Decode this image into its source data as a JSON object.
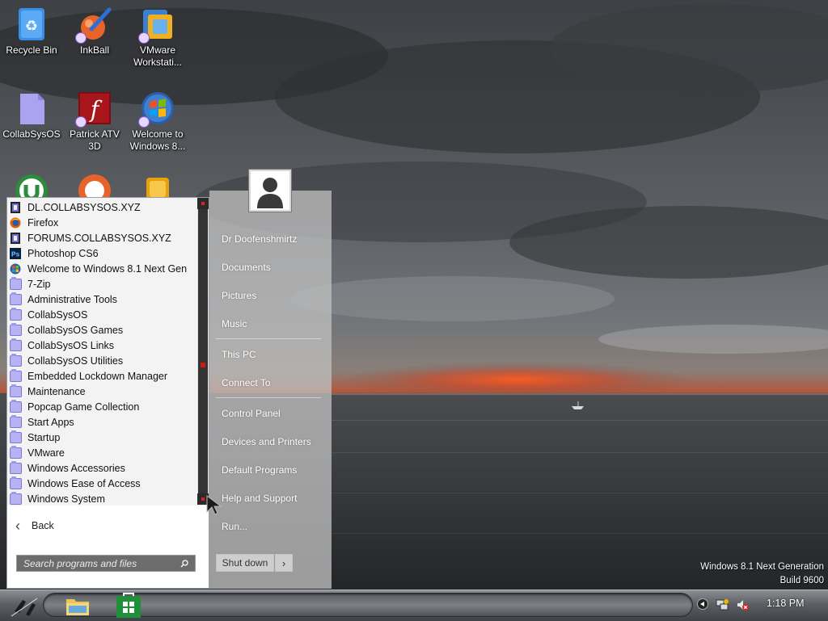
{
  "desktop": {
    "icons": [
      {
        "label": "Recycle Bin"
      },
      {
        "label": "InkBall"
      },
      {
        "label": "VMware Workstati..."
      },
      {
        "label": "CollabSysOS"
      },
      {
        "label": "Patrick ATV 3D"
      },
      {
        "label": "Welcome to Windows 8..."
      }
    ]
  },
  "start_menu": {
    "programs": [
      {
        "label": "DL.COLLABSYSOS.XYZ",
        "icon": "web-page-icon"
      },
      {
        "label": "Firefox",
        "icon": "firefox-icon"
      },
      {
        "label": "FORUMS.COLLABSYSOS.XYZ",
        "icon": "web-page-icon"
      },
      {
        "label": "Photoshop CS6",
        "icon": "photoshop-icon"
      },
      {
        "label": "Welcome to Windows 8.1 Next Gen",
        "icon": "windows-orb-icon"
      },
      {
        "label": "7-Zip",
        "icon": "folder-icon"
      },
      {
        "label": "Administrative Tools",
        "icon": "folder-icon"
      },
      {
        "label": "CollabSysOS",
        "icon": "folder-icon"
      },
      {
        "label": "CollabSysOS Games",
        "icon": "folder-icon"
      },
      {
        "label": "CollabSysOS Links",
        "icon": "folder-icon"
      },
      {
        "label": "CollabSysOS Utilities",
        "icon": "folder-icon"
      },
      {
        "label": "Embedded Lockdown Manager",
        "icon": "folder-icon"
      },
      {
        "label": "Maintenance",
        "icon": "folder-icon"
      },
      {
        "label": "Popcap Game Collection",
        "icon": "folder-icon"
      },
      {
        "label": "Start Apps",
        "icon": "folder-icon"
      },
      {
        "label": "Startup",
        "icon": "folder-icon"
      },
      {
        "label": "VMware",
        "icon": "folder-icon"
      },
      {
        "label": "Windows Accessories",
        "icon": "folder-icon"
      },
      {
        "label": "Windows Ease of Access",
        "icon": "folder-icon"
      },
      {
        "label": "Windows System",
        "icon": "folder-icon"
      }
    ],
    "back_label": "Back",
    "search_placeholder": "Search programs and files",
    "right_items": [
      "Dr Doofenshmirtz",
      "Documents",
      "Pictures",
      "Music",
      "This PC",
      "Connect To",
      "Control Panel",
      "Devices and Printers",
      "Default Programs",
      "Help and Support",
      "Run..."
    ],
    "shutdown_label": "Shut down",
    "shutdown_arrow": "›"
  },
  "watermark": {
    "line1": "Windows 8.1 Next Generation",
    "line2": "Build 9600"
  },
  "taskbar": {
    "clock": "1:18 PM",
    "pinned": [
      "file-explorer-icon",
      "store-icon"
    ]
  },
  "colors": {
    "taskbar_gradient_top": "#8b8e92",
    "folder_icon": "#b7b3f2",
    "scrollbar_accent": "#d01818"
  }
}
